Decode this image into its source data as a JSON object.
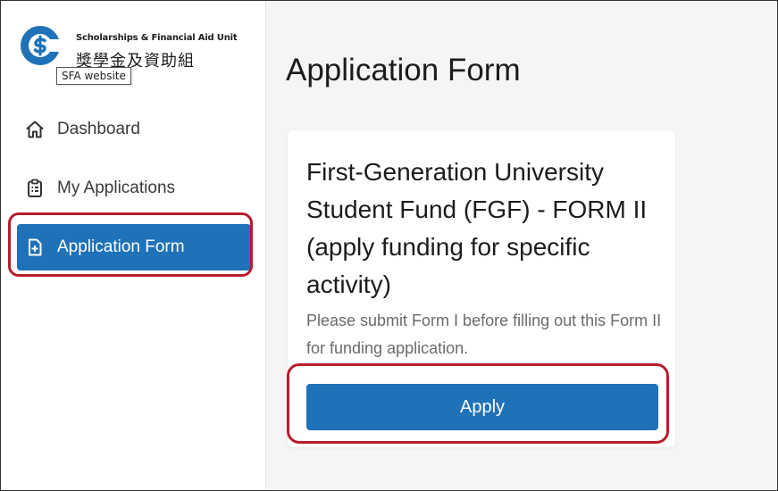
{
  "logo": {
    "text_en": "Scholarships & Financial Aid Unit",
    "text_zh": "獎學金及資助組",
    "tooltip": "SFA website",
    "brand_color": "#1f72b8"
  },
  "sidebar": {
    "items": [
      {
        "label": "Dashboard",
        "icon": "home-icon",
        "active": false
      },
      {
        "label": "My Applications",
        "icon": "clipboard-list-icon",
        "active": false
      },
      {
        "label": "Application Form",
        "icon": "file-plus-icon",
        "active": true
      }
    ]
  },
  "main": {
    "page_title": "Application Form",
    "card": {
      "title": "First-Generation University Student Fund (FGF) - FORM II (apply funding for specific activity)",
      "description": "Please submit Form I before filling out this Form II for funding application.",
      "apply_label": "Apply"
    }
  },
  "colors": {
    "accent": "#1f72b8",
    "highlight": "#b81c2e",
    "background": "#f5f5f5"
  }
}
